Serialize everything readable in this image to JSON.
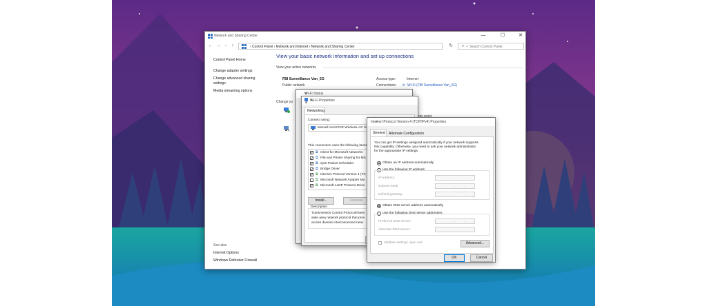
{
  "window": {
    "title": "Network and Sharing Center",
    "minimize": "—",
    "maximize": "☐",
    "close": "✕"
  },
  "address_bar": {
    "crumbs": "›  Control Panel  ›  Network and Internet  ›  Network and Sharing Center",
    "search_placeholder": "Search Control Panel"
  },
  "sidebar": {
    "items": [
      "Control Panel Home",
      "Change adapter settings",
      "Change advanced sharing",
      "settings",
      "Media streaming options"
    ],
    "see_also_label": "See also",
    "see_also": [
      "Internet Options",
      "Windows Defender Firewall"
    ]
  },
  "main": {
    "heading": "View your basic network information and set up connections",
    "active_label": "View your active networks",
    "network_name": "FBI Surveillance Van_5G",
    "network_type": "Public network",
    "access_type_label": "Access type:",
    "access_type_value": "Internet",
    "connections_label": "Connections:",
    "connections_value": "Wi-Fi (FBI Surveillance Van_5G)",
    "change_label": "Change yo",
    "partial_link": "ess point"
  },
  "wifi_status": {
    "title": "Wi-Fi Status"
  },
  "wifi_properties": {
    "title": "Wi-Fi Properties",
    "tab": "Networking",
    "connect_using_label": "Connect using:",
    "adapter": "Marvell AVASTAR Wireless-AC N",
    "items_label": "This connection uses the following items:",
    "items": [
      {
        "label": "Client for Microsoft Networks",
        "checked": true
      },
      {
        "label": "File and Printer Sharing for Mic",
        "checked": true
      },
      {
        "label": "QoS Packet Scheduler",
        "checked": true
      },
      {
        "label": "Bridge Driver",
        "checked": true
      },
      {
        "label": "Internet Protocol Version 4 (TC",
        "checked": true
      },
      {
        "label": "Microsoft Network Adapter Mu",
        "checked": false
      },
      {
        "label": "Microsoft LLDP Protocol Drive",
        "checked": true
      }
    ],
    "install_label": "Install...",
    "uninstall_label": "Uninstall",
    "description_label": "Description",
    "description_lines": [
      "Transmission Control Protocol/Intern",
      "wide area network protocol that prov",
      "across diverse interconnected netw"
    ]
  },
  "ipv4": {
    "title": "Internet Protocol Version 4 (TCP/IPv4) Properties",
    "tab_general": "General",
    "tab_alternate": "Alternate Configuration",
    "intro_lines": [
      "You can get IP settings assigned automatically if your network supports",
      "this capability. Otherwise, you need to ask your network administrator",
      "for the appropriate IP settings."
    ],
    "auto_ip": "Obtain an IP address automatically",
    "manual_ip": "Use the following IP address:",
    "ip_label": "IP address:",
    "mask_label": "Subnet mask:",
    "gateway_label": "Default gateway:",
    "auto_dns": "Obtain DNS server address automatically",
    "manual_dns": "Use the following DNS server addresses:",
    "pref_dns_label": "Preferred DNS server:",
    "alt_dns_label": "Alternate DNS server:",
    "validate_label": "Validate settings upon exit",
    "advanced_label": "Advanced...",
    "ok_label": "OK",
    "cancel_label": "Cancel"
  }
}
